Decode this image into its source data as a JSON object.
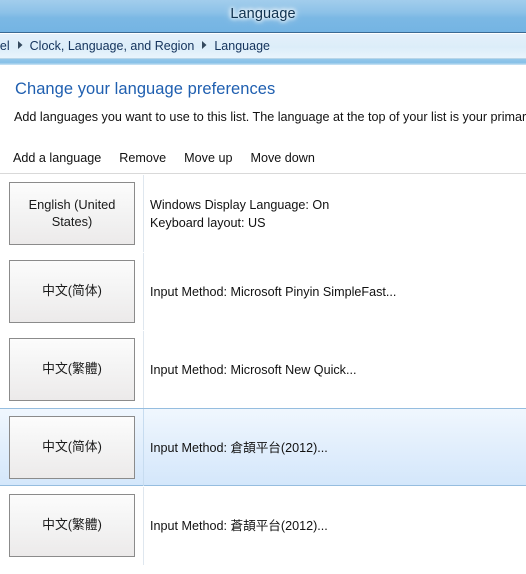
{
  "window": {
    "title": "Language"
  },
  "breadcrumb": {
    "separator_icon": "chevron-right-icon",
    "items": [
      {
        "label": "anel"
      },
      {
        "label": "Clock, Language, and Region"
      },
      {
        "label": "Language"
      }
    ]
  },
  "page": {
    "heading": "Change your language preferences",
    "description": "Add languages you want to use to this list. The language at the top of your list is your primary lan"
  },
  "commandbar": {
    "buttons": [
      {
        "label": "Add a language"
      },
      {
        "label": "Remove"
      },
      {
        "label": "Move up"
      },
      {
        "label": "Move down"
      }
    ]
  },
  "language_list": {
    "rows": [
      {
        "language": "English (United States)",
        "selected": false,
        "details": [
          "Windows Display Language: On",
          "Keyboard layout: US"
        ]
      },
      {
        "language": "中文(简体)",
        "selected": false,
        "details": [
          "Input Method: Microsoft Pinyin SimpleFast..."
        ]
      },
      {
        "language": "中文(繁體)",
        "selected": false,
        "details": [
          "Input Method: Microsoft New Quick..."
        ]
      },
      {
        "language": "中文(简体)",
        "selected": true,
        "details": [
          "Input Method: 倉頡平台(2012)..."
        ]
      },
      {
        "language": "中文(繁體)",
        "selected": false,
        "details": [
          "Input Method: 蒼頡平台(2012)..."
        ]
      }
    ]
  },
  "colors": {
    "titlebar_blue": "#7bb8e4",
    "heading_blue": "#1f5fb0",
    "selection_blue": "#d4e7fb",
    "selection_border": "#95bddf",
    "box_border": "#8b8b8b"
  }
}
